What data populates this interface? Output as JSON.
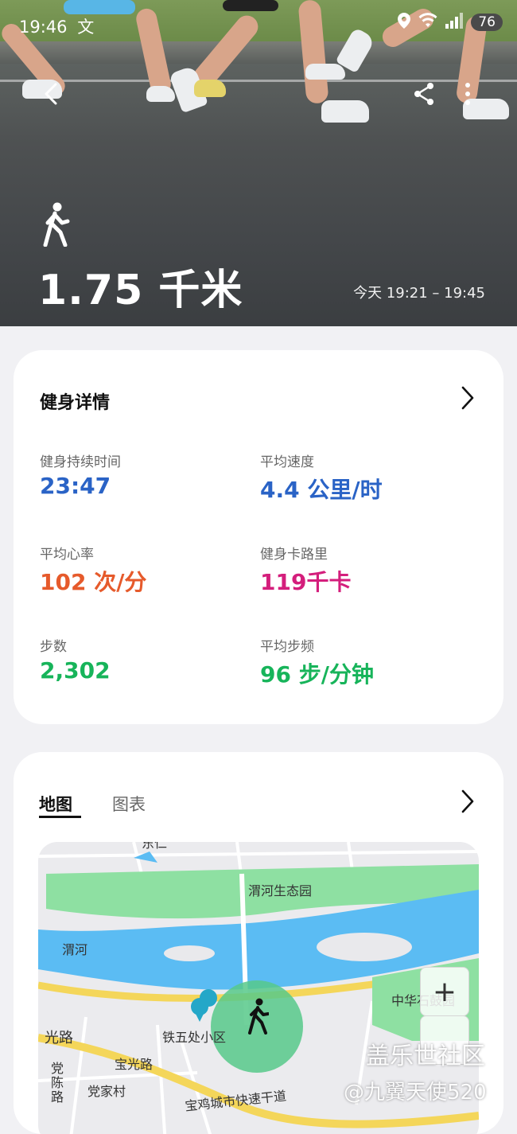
{
  "status_bar": {
    "time": "19:46",
    "carrier_icon": "文",
    "battery": "76"
  },
  "workout": {
    "type_icon": "walking-icon",
    "distance": "1.75 千米",
    "time_range": "今天 19:21 – 19:45"
  },
  "details": {
    "title": "健身详情",
    "stats": [
      {
        "label": "健身持续时间",
        "value": "23:47",
        "color": "#2a63c6"
      },
      {
        "label": "平均速度",
        "value": "4.4 公里/时",
        "color": "#2a63c6"
      },
      {
        "label": "平均心率",
        "value": "102 次/分",
        "color": "#e65a2b"
      },
      {
        "label": "健身卡路里",
        "value": "119千卡",
        "color": "#d41e7c"
      },
      {
        "label": "步数",
        "value": "2,302",
        "color": "#17b45a"
      },
      {
        "label": "平均步频",
        "value": "96 步/分钟",
        "color": "#17b45a"
      }
    ]
  },
  "map_section": {
    "tabs": [
      "地图",
      "图表"
    ],
    "active_tab": "地图",
    "labels": {
      "park": "渭河生态园",
      "river": "渭河",
      "community": "铁五处小区",
      "guang_road": "光路",
      "baoguang_road": "宝光路",
      "dangchen_road": "党陈路",
      "dangjia_village": "党家村",
      "expressway": "宝鸡城市快速干道",
      "zhonghua_park": "中华石鼓园",
      "top_road": "东仁"
    },
    "zoom_in": "+"
  },
  "watermark": {
    "line1": "盖乐世社区",
    "line2": "@九翼天使520"
  },
  "colors": {
    "blue": "#2a63c6",
    "orange": "#e65a2b",
    "magenta": "#d41e7c",
    "green": "#17b45a",
    "river": "#5bbcf3",
    "park": "#8ee0a2",
    "road": "#f4d65a"
  }
}
